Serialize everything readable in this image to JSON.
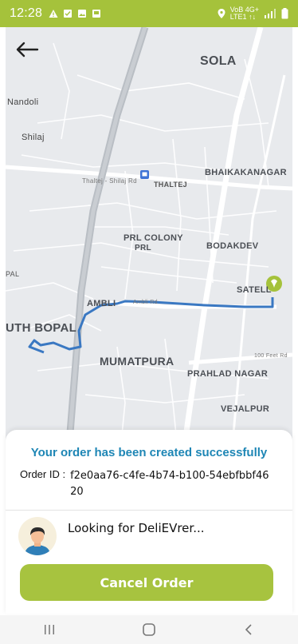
{
  "status_bar": {
    "time": "12:28",
    "network_top": "VoB 4G+",
    "network_bottom": "LTE1 ↑↓"
  },
  "map": {
    "labels": {
      "sola": "SOLA",
      "nandoli": "Nandoli",
      "shilaj": "Shilaj",
      "thaltej": "THALTEJ",
      "bhaikakanagar": "BHAIKAKANAGAR",
      "prl_colony": "PRL COLONY",
      "prl": "PRL",
      "bodakdev": "BODAKDEV",
      "pal": "PAL",
      "satell": "SATELL",
      "ambli": "AMBLI",
      "south_bopal": "UTH BOPAL",
      "mumatpura": "MUMATPURA",
      "prahlad_nagar": "PRAHLAD NAGAR",
      "vejalpur": "VEJALPUR",
      "road_thaltej_shilaj": "Thaltej - Shilaj Rd",
      "road_ambli": "Ambli Rd",
      "road_100ft": "100 Feet Rd"
    }
  },
  "sheet": {
    "title": "Your order has been created successfully",
    "order_label": "Order ID :",
    "order_id": "f2e0aa76-c4fe-4b74-b100-54ebfbbf4620",
    "status_text": "Looking for DeliEVrer...",
    "cancel_label": "Cancel Order"
  },
  "colors": {
    "brand": "#a5c23b",
    "title": "#1e86b5",
    "route": "#3a78c2"
  },
  "icons": {
    "back": "arrow-left-icon",
    "nav_recent": "recents-icon",
    "nav_home": "home-icon",
    "nav_back": "back-chevron-icon"
  }
}
